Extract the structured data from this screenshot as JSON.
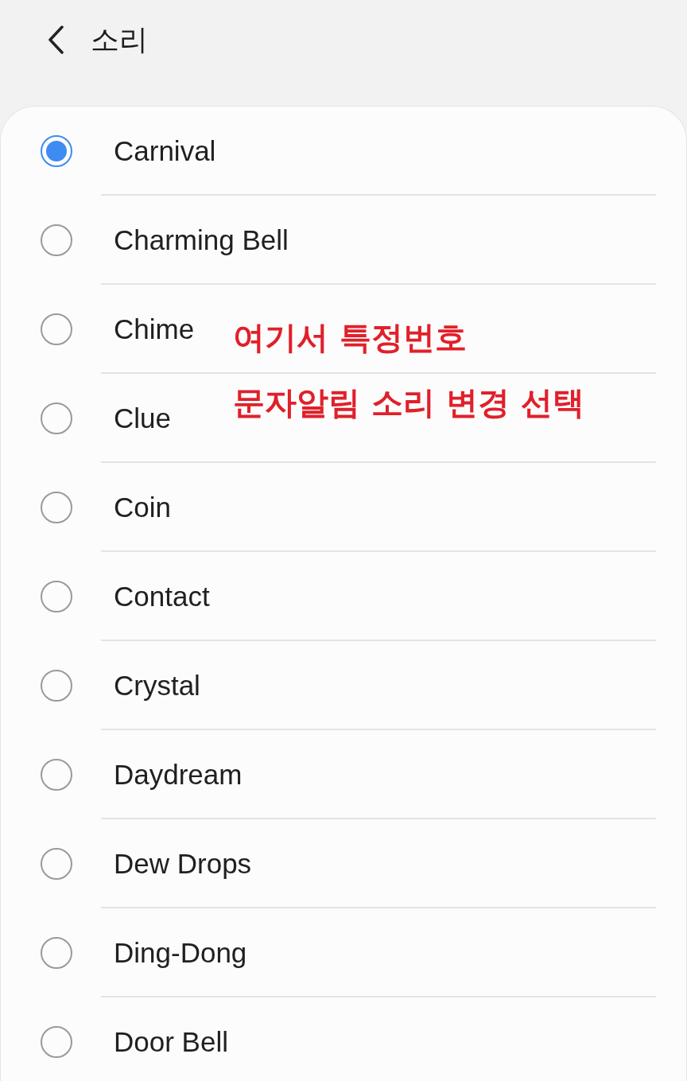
{
  "header": {
    "title": "소리"
  },
  "options": [
    {
      "label": "Carnival",
      "selected": true
    },
    {
      "label": "Charming Bell",
      "selected": false
    },
    {
      "label": "Chime",
      "selected": false
    },
    {
      "label": "Clue",
      "selected": false
    },
    {
      "label": "Coin",
      "selected": false
    },
    {
      "label": "Contact",
      "selected": false
    },
    {
      "label": "Crystal",
      "selected": false
    },
    {
      "label": "Daydream",
      "selected": false
    },
    {
      "label": "Dew Drops",
      "selected": false
    },
    {
      "label": "Ding-Dong",
      "selected": false
    },
    {
      "label": "Door Bell",
      "selected": false
    }
  ],
  "annotation": [
    "여기서 특정번호",
    "문자알림 소리 변경 선택"
  ]
}
